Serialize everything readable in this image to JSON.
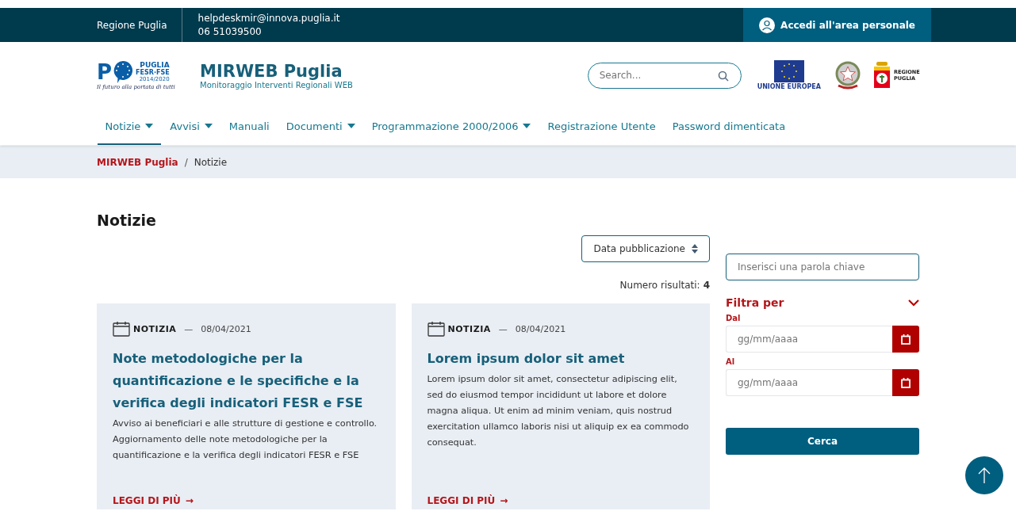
{
  "top_bar": {
    "region": "Regione Puglia",
    "email": "helpdeskmir@innova.puglia.it",
    "phone": "06 51039500",
    "login": "Accedi all'area personale"
  },
  "header": {
    "logo": {
      "letter": "P",
      "name": "PUGLIA",
      "funds": "FESR·FSE",
      "years": "2014/2020",
      "motto": "Il futuro alla portata di tutti"
    },
    "title": "MIRWEB Puglia",
    "subtitle": "Monitoraggio Interventi Regionali WEB",
    "search": {
      "placeholder": "Search..."
    },
    "eu_label": "UNIONE EUROPEA",
    "region_logo": "REGIONE PUGLIA"
  },
  "nav": [
    {
      "label": "Notizie",
      "dropdown": true,
      "selected": true
    },
    {
      "label": "Avvisi",
      "dropdown": true,
      "selected": false
    },
    {
      "label": "Manuali",
      "dropdown": false,
      "selected": false
    },
    {
      "label": "Documenti",
      "dropdown": true,
      "selected": false
    },
    {
      "label": "Programmazione 2000/2006",
      "dropdown": true,
      "selected": false
    },
    {
      "label": "Registrazione Utente",
      "dropdown": false,
      "selected": false
    },
    {
      "label": "Password dimenticata",
      "dropdown": false,
      "selected": false
    }
  ],
  "breadcrumb": [
    {
      "label": "MIRWEB Puglia",
      "link": true
    },
    {
      "label": "Notizie",
      "link": false
    }
  ],
  "breadcrumb_separator": "/",
  "page_title": "Notizie",
  "sort": {
    "label": "Data pubblicazione"
  },
  "results": {
    "label": "Numero risultati:",
    "count": "4"
  },
  "cards": [
    {
      "type": "NOTIZIA",
      "dash": "—",
      "date": "08/04/2021",
      "title": "Note metodologiche per la quantificazione e le specifiche e la verifica degli indicatori FESR e FSE",
      "text": "Avviso ai beneficiari e alle strutture di gestione e controllo. Aggiornamento delle note metodologiche per la quantificazione e la verifica degli indicatori FESR e FSE",
      "link": "LEGGI DI PIÙ",
      "arrow": "→"
    },
    {
      "type": "NOTIZIA",
      "dash": "—",
      "date": "08/04/2021",
      "title": "Lorem ipsum dolor sit amet",
      "text": "Lorem ipsum dolor sit amet, consectetur adipiscing elit, sed do eiusmod tempor incididunt ut labore et dolore magna aliqua. Ut enim ad minim veniam, quis nostrud exercitation ullamco laboris nisi ut aliquip ex ea commodo consequat.",
      "link": "LEGGI DI PIÙ",
      "arrow": "→"
    }
  ],
  "filter": {
    "keyword": {
      "placeholder": "Inserisci una parola chiave"
    },
    "title": "Filtra per",
    "expanded": true,
    "dates": [
      {
        "label": "Dal",
        "placeholder": "gg/mm/aaaa"
      },
      {
        "label": "Al",
        "placeholder": "gg/mm/aaaa"
      }
    ],
    "button": "Cerca"
  }
}
